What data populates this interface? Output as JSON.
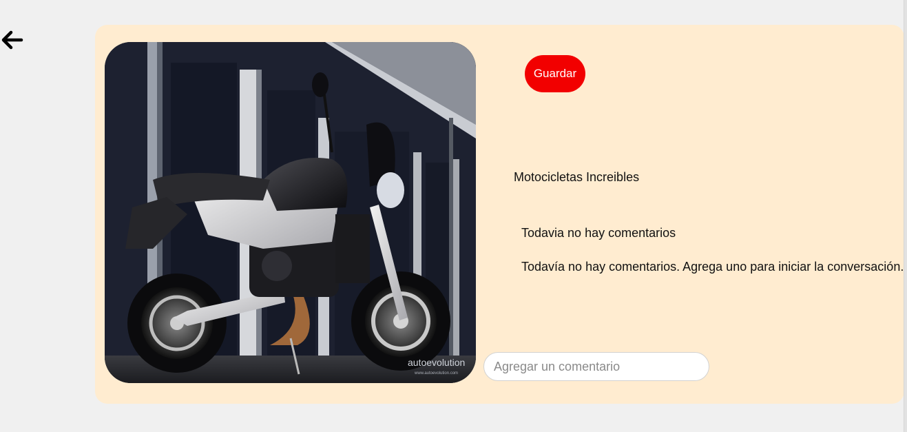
{
  "navigation": {
    "back_icon": "arrow-left-icon"
  },
  "pin": {
    "image": {
      "icon": "motorcycle-photo",
      "watermark": "autoevolution",
      "watermark_url": "www.autoevolution.com"
    },
    "save_label": "Guardar",
    "save_color": "#f20000",
    "board_title": "Motocicletas Increibles"
  },
  "comments": {
    "heading": "Todavia no hay comentarios",
    "empty_message": "Todavía no hay comentarios. Agrega uno para iniciar la conversación.",
    "input_placeholder": "Agregar un comentario",
    "input_value": ""
  },
  "colors": {
    "page_background": "#f0f0f0",
    "card_background": "#ffecd0"
  }
}
